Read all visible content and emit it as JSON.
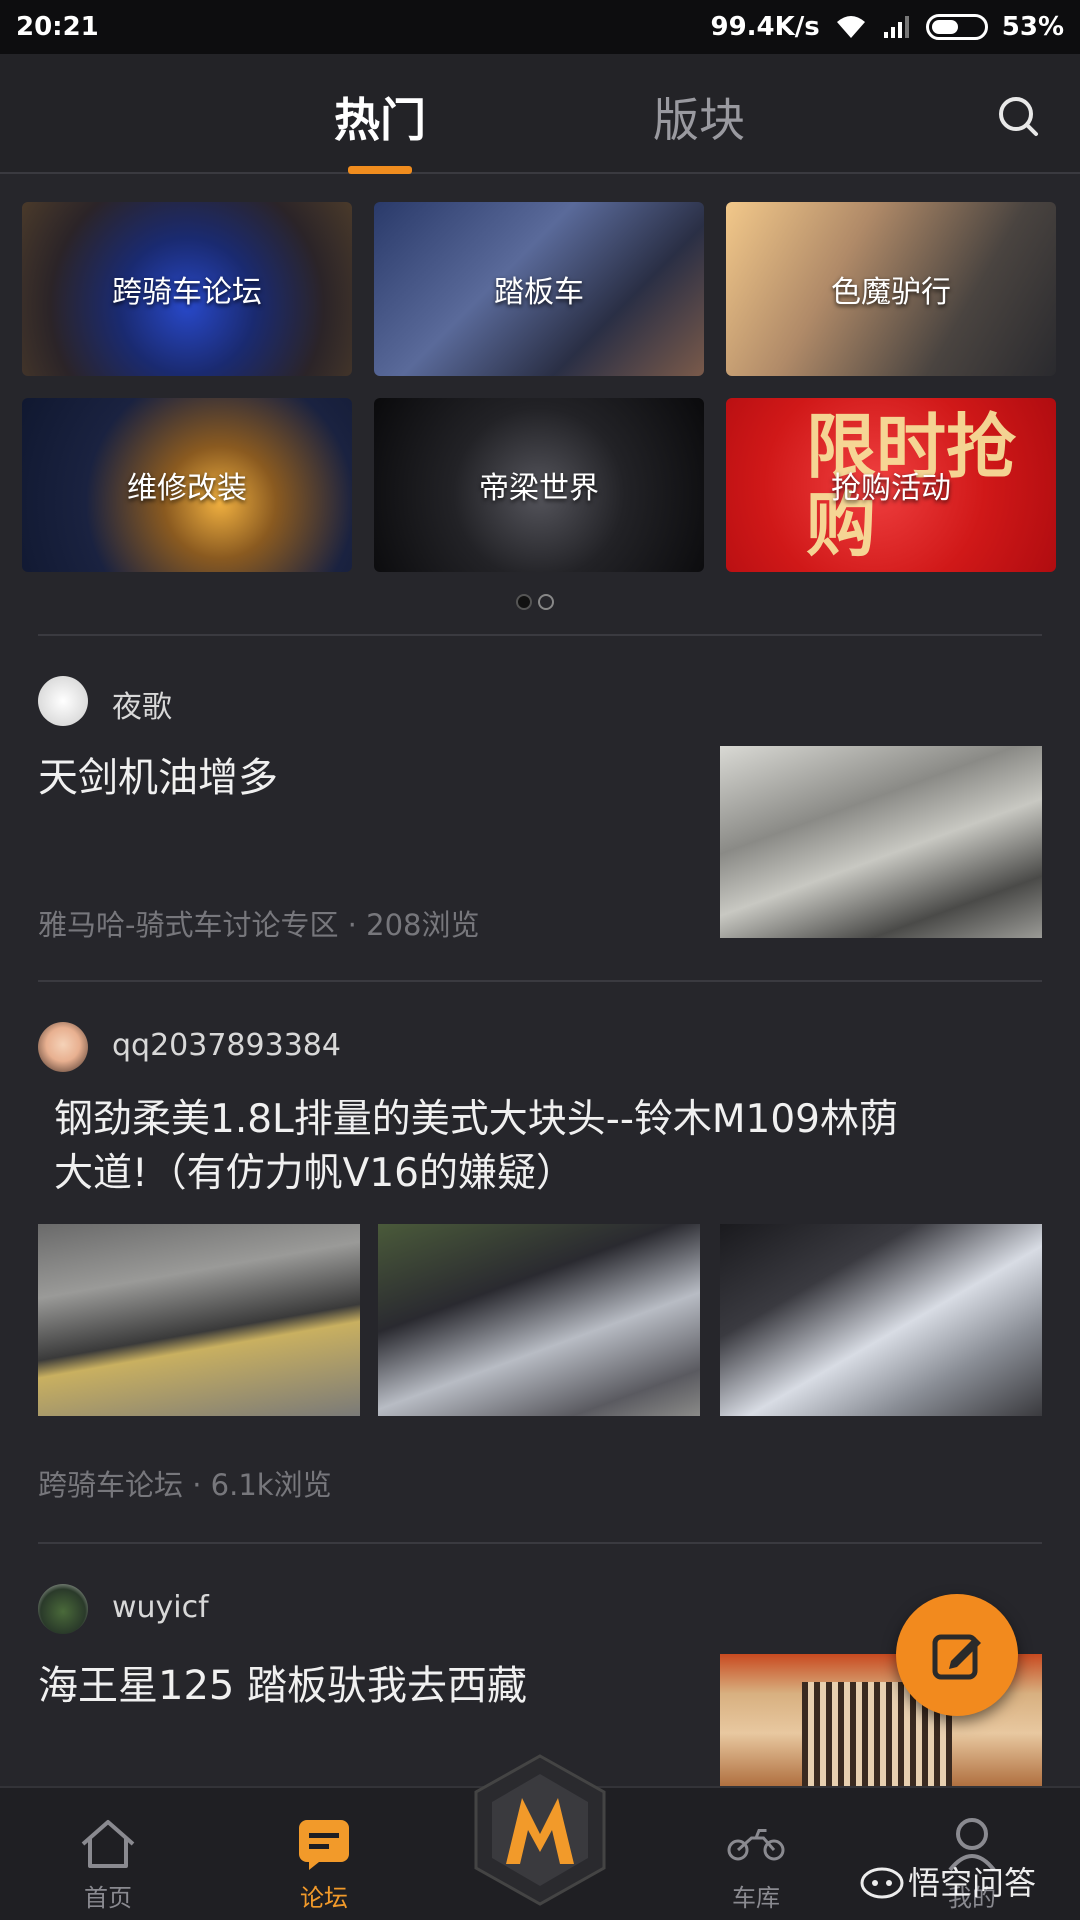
{
  "status_bar": {
    "time": "20:21",
    "speed": "99.4K/s",
    "battery": "53%"
  },
  "top_tabs": {
    "hot": "热门",
    "block": "版块"
  },
  "boards": [
    {
      "label": "跨骑车论坛"
    },
    {
      "label": "踏板车"
    },
    {
      "label": "色魔驴行"
    },
    {
      "label": "维修改装"
    },
    {
      "label": "帝梁世界"
    },
    {
      "label": "抢购活动",
      "banner_text": "限时抢购"
    }
  ],
  "posts": [
    {
      "user": "夜歌",
      "title": "天剑机油增多",
      "meta": "雅马哈-骑式车讨论专区 · 208浏览"
    },
    {
      "user": "qq2037893384",
      "title_line1": "钢劲柔美1.8L排量的美式大块头--铃木M109林荫",
      "title_line2": "大道!（有仿力帆V16的嫌疑）",
      "meta": "跨骑车论坛 · 6.1k浏览"
    },
    {
      "user": "wuyicf",
      "title": "海王星125 踏板驮我去西藏"
    }
  ],
  "bottom_nav": {
    "home": "首页",
    "forum": "论坛",
    "garage": "车库",
    "mine": "我的"
  },
  "watermark": "悟空问答",
  "colors": {
    "accent": "#f08c1e",
    "background": "#26262b"
  }
}
